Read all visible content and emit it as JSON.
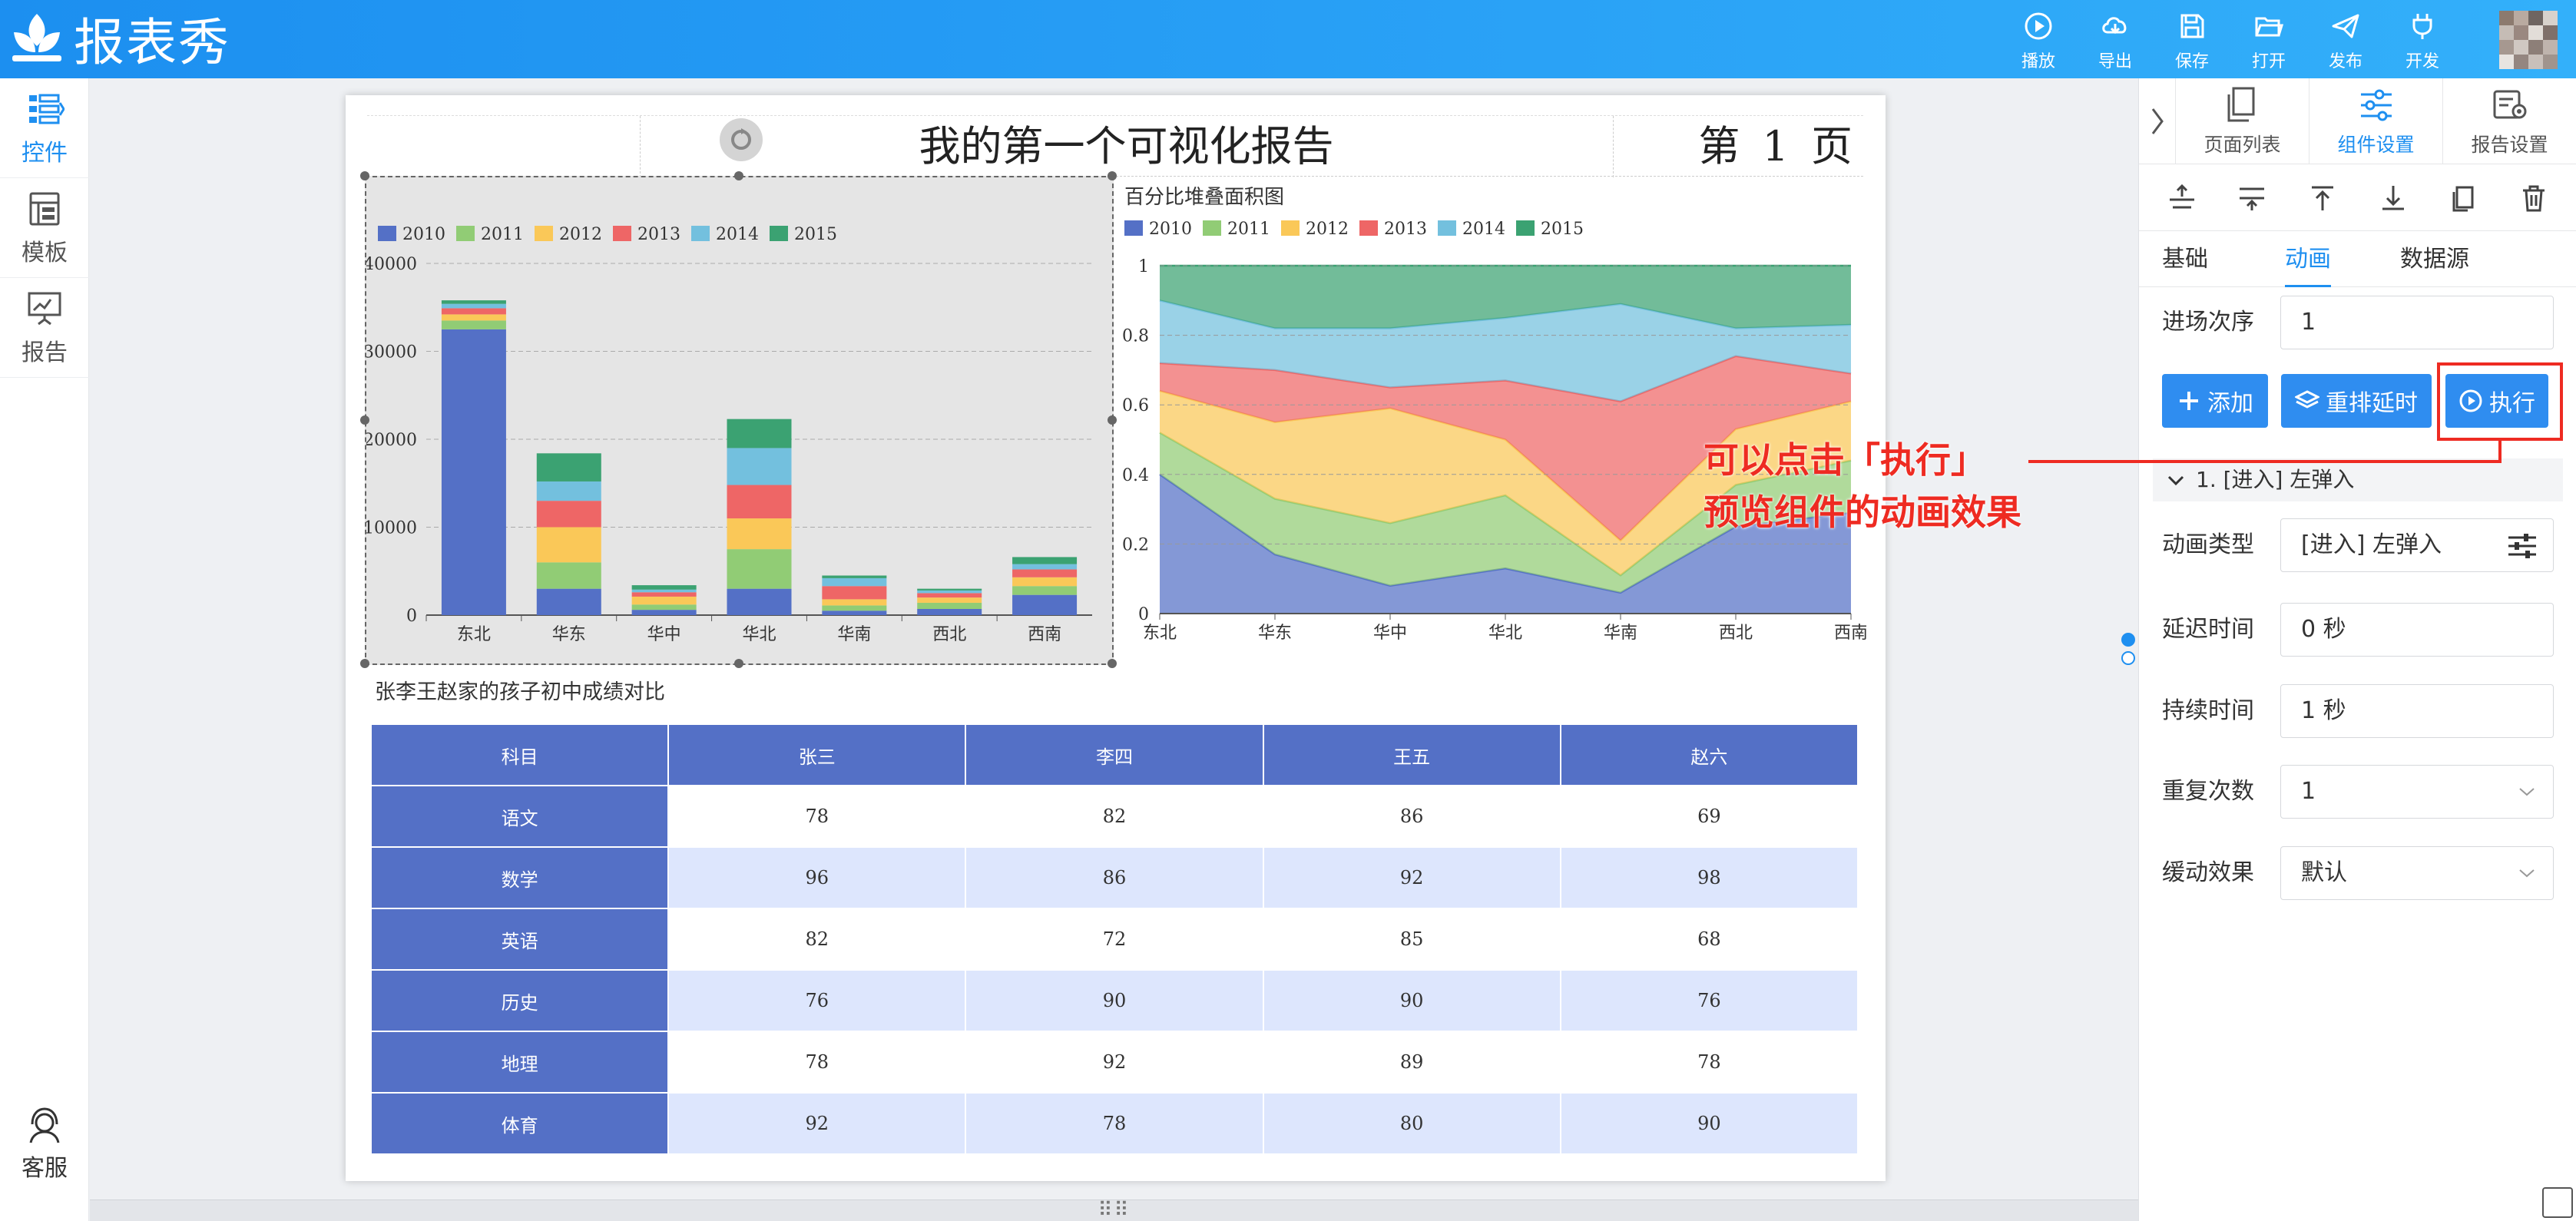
{
  "app": {
    "name": "报表秀"
  },
  "toolbar": [
    {
      "id": "play",
      "label": "播放"
    },
    {
      "id": "export",
      "label": "导出"
    },
    {
      "id": "save",
      "label": "保存"
    },
    {
      "id": "open",
      "label": "打开"
    },
    {
      "id": "publish",
      "label": "发布"
    },
    {
      "id": "develop",
      "label": "开发"
    }
  ],
  "sidebar": {
    "items": [
      {
        "label": "控件",
        "icon": "widgets-icon",
        "active": true
      },
      {
        "label": "模板",
        "icon": "template-icon",
        "active": false
      },
      {
        "label": "报告",
        "icon": "report-icon",
        "active": false
      }
    ],
    "service": "客服"
  },
  "report": {
    "title": "我的第一个可视化报告",
    "page_label": "第 1 页",
    "table_title": "张李王赵家的孩子初中成绩对比"
  },
  "chart_data": [
    {
      "type": "bar",
      "stacked": true,
      "title": "",
      "categories": [
        "东北",
        "华东",
        "华中",
        "华北",
        "华南",
        "西北",
        "西南"
      ],
      "ylim": [
        0,
        40000
      ],
      "yticks": [
        0,
        10000,
        20000,
        30000,
        40000
      ],
      "grid": true,
      "legend_position": "top-left",
      "series": [
        {
          "name": "2010",
          "values": [
            32500,
            3000,
            600,
            3000,
            500,
            700,
            2300
          ]
        },
        {
          "name": "2011",
          "values": [
            1000,
            3000,
            600,
            4500,
            600,
            700,
            1000
          ]
        },
        {
          "name": "2012",
          "values": [
            700,
            4000,
            900,
            3500,
            700,
            600,
            1000
          ]
        },
        {
          "name": "2013",
          "values": [
            700,
            3000,
            500,
            3800,
            1500,
            500,
            900
          ]
        },
        {
          "name": "2014",
          "values": [
            500,
            2200,
            300,
            4200,
            900,
            300,
            600
          ]
        },
        {
          "name": "2015",
          "values": [
            400,
            3200,
            500,
            3300,
            300,
            200,
            800
          ]
        }
      ],
      "colors": [
        "#5470c6",
        "#91cc75",
        "#fac858",
        "#ee6666",
        "#73c0de",
        "#3ba272"
      ]
    },
    {
      "type": "area",
      "stacked_percent": true,
      "title": "百分比堆叠面积图",
      "categories": [
        "东北",
        "华东",
        "华中",
        "华北",
        "华南",
        "西北",
        "西南"
      ],
      "ylim": [
        0,
        1
      ],
      "yticks": [
        0,
        0.2,
        0.4,
        0.6,
        0.8,
        1
      ],
      "grid": true,
      "legend_position": "top-left",
      "series": [
        {
          "name": "2010",
          "values": [
            0.4,
            0.17,
            0.08,
            0.13,
            0.06,
            0.25,
            0.29
          ]
        },
        {
          "name": "2011",
          "values": [
            0.12,
            0.16,
            0.18,
            0.21,
            0.05,
            0.12,
            0.15
          ]
        },
        {
          "name": "2012",
          "values": [
            0.12,
            0.22,
            0.33,
            0.16,
            0.1,
            0.16,
            0.17
          ]
        },
        {
          "name": "2013",
          "values": [
            0.08,
            0.15,
            0.06,
            0.17,
            0.4,
            0.21,
            0.08
          ]
        },
        {
          "name": "2014",
          "values": [
            0.18,
            0.12,
            0.17,
            0.18,
            0.28,
            0.08,
            0.14
          ]
        },
        {
          "name": "2015",
          "values": [
            0.1,
            0.18,
            0.18,
            0.15,
            0.11,
            0.18,
            0.17
          ]
        }
      ],
      "colors": [
        "#5470c6",
        "#91cc75",
        "#fac858",
        "#ee6666",
        "#73c0de",
        "#3ba272"
      ]
    },
    {
      "type": "table",
      "headers": [
        "科目",
        "张三",
        "李四",
        "王五",
        "赵六"
      ],
      "rows": [
        [
          "语文",
          "78",
          "82",
          "86",
          "69"
        ],
        [
          "数学",
          "96",
          "86",
          "92",
          "98"
        ],
        [
          "英语",
          "82",
          "72",
          "85",
          "68"
        ],
        [
          "历史",
          "76",
          "90",
          "90",
          "76"
        ],
        [
          "地理",
          "78",
          "92",
          "89",
          "78"
        ],
        [
          "体育",
          "92",
          "78",
          "80",
          "90"
        ]
      ]
    }
  ],
  "panel": {
    "tabs": [
      {
        "label": "页面列表",
        "active": false
      },
      {
        "label": "组件设置",
        "active": true
      },
      {
        "label": "报告设置",
        "active": false
      }
    ],
    "subtabs": [
      {
        "label": "基础",
        "active": false
      },
      {
        "label": "动画",
        "active": true
      },
      {
        "label": "数据源",
        "active": false
      }
    ],
    "order": {
      "label": "进场次序",
      "value": "1"
    },
    "buttons": {
      "add": "添加",
      "reorder": "重排延时",
      "run": "执行"
    },
    "animation_item": "1. [进入] 左弹入",
    "fields": {
      "type": {
        "label": "动画类型",
        "value": "[进入] 左弹入"
      },
      "delay": {
        "label": "延迟时间",
        "value": "0 秒"
      },
      "duration": {
        "label": "持续时间",
        "value": "1 秒"
      },
      "repeat": {
        "label": "重复次数",
        "value": "1"
      },
      "easing": {
        "label": "缓动效果",
        "value": "默认"
      }
    }
  },
  "annotation": {
    "line1": "可以点击「执行」",
    "line2": "预览组件的动画效果"
  },
  "colors": {
    "accent": "#1e8ff0",
    "header_from": "#1c8ff0",
    "annotation": "#ee2b22",
    "table_header": "#5470c6",
    "table_stripe": "#dde6fd"
  }
}
